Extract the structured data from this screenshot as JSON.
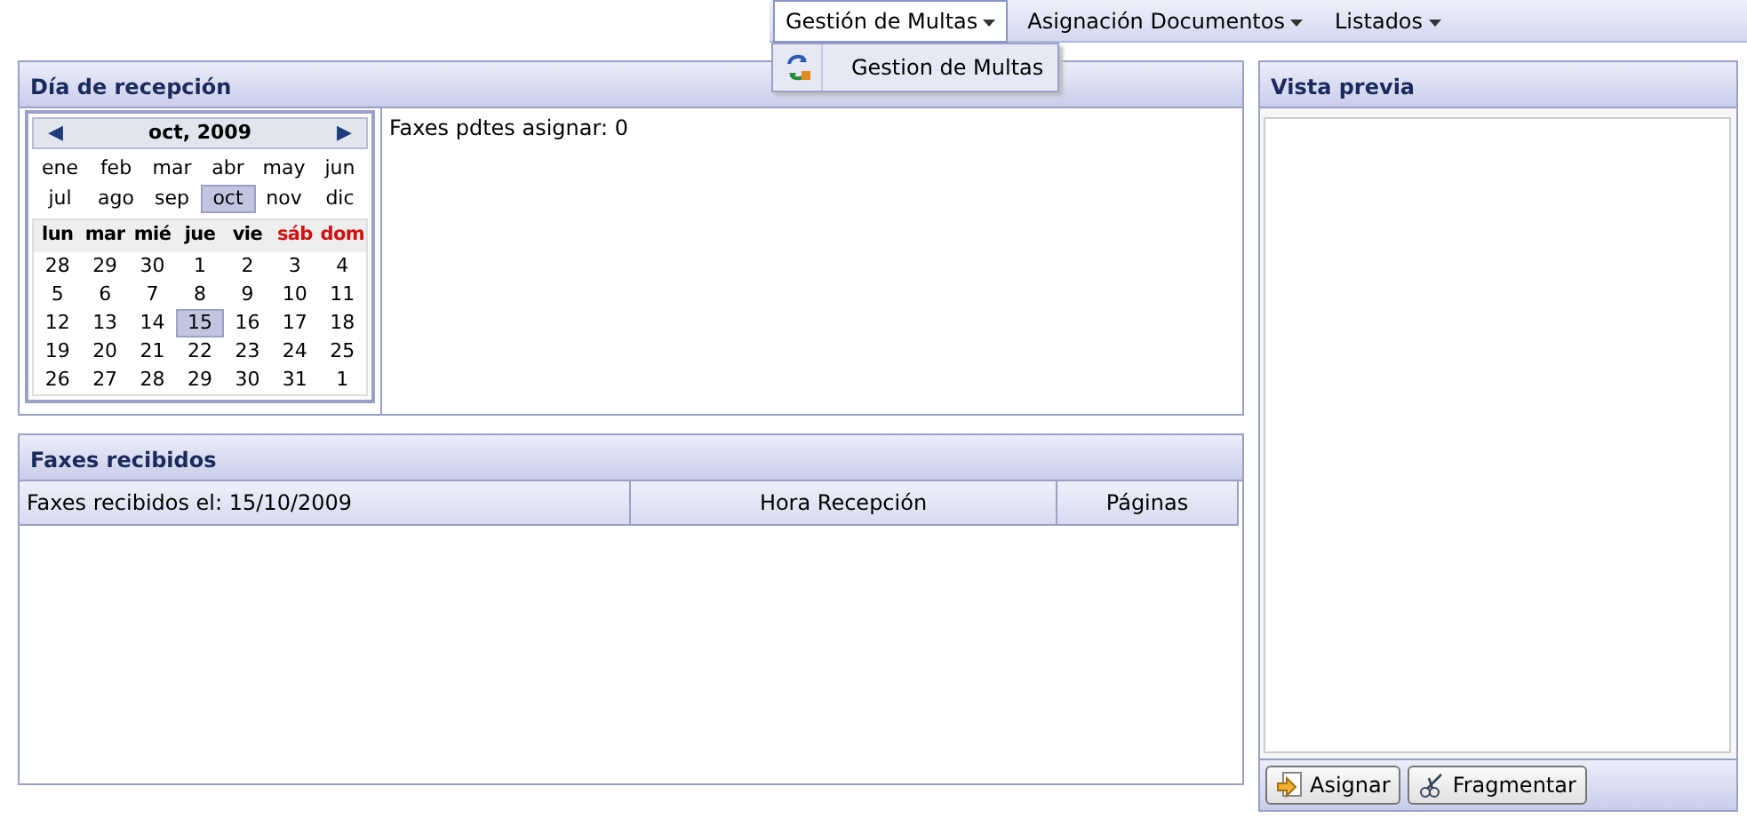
{
  "menubar": [
    {
      "label": "Gestión de Multas",
      "expanded": true,
      "items": [
        {
          "label": "Gestion de Multas"
        }
      ]
    },
    {
      "label": "Asignación Documentos",
      "expanded": false
    },
    {
      "label": "Listados",
      "expanded": false
    }
  ],
  "reception": {
    "title": "Día de recepción",
    "calendar": {
      "prev": "◀",
      "next": "▶",
      "title": "oct, 2009",
      "months": [
        {
          "label": "ene",
          "selected": false
        },
        {
          "label": "feb",
          "selected": false
        },
        {
          "label": "mar",
          "selected": false
        },
        {
          "label": "abr",
          "selected": false
        },
        {
          "label": "may",
          "selected": false
        },
        {
          "label": "jun",
          "selected": false
        },
        {
          "label": "jul",
          "selected": false
        },
        {
          "label": "ago",
          "selected": false
        },
        {
          "label": "sep",
          "selected": false
        },
        {
          "label": "oct",
          "selected": true
        },
        {
          "label": "nov",
          "selected": false
        },
        {
          "label": "dic",
          "selected": false
        }
      ],
      "weekdays": [
        {
          "label": "lun",
          "weekend": false
        },
        {
          "label": "mar",
          "weekend": false
        },
        {
          "label": "mié",
          "weekend": false
        },
        {
          "label": "jue",
          "weekend": false
        },
        {
          "label": "vie",
          "weekend": false
        },
        {
          "label": "sáb",
          "weekend": true
        },
        {
          "label": "dom",
          "weekend": true
        }
      ],
      "weeks": [
        [
          {
            "label": "28",
            "selected": false
          },
          {
            "label": "29",
            "selected": false
          },
          {
            "label": "30",
            "selected": false
          },
          {
            "label": "1",
            "selected": false
          },
          {
            "label": "2",
            "selected": false
          },
          {
            "label": "3",
            "selected": false
          },
          {
            "label": "4",
            "selected": false
          }
        ],
        [
          {
            "label": "5",
            "selected": false
          },
          {
            "label": "6",
            "selected": false
          },
          {
            "label": "7",
            "selected": false
          },
          {
            "label": "8",
            "selected": false
          },
          {
            "label": "9",
            "selected": false
          },
          {
            "label": "10",
            "selected": false
          },
          {
            "label": "11",
            "selected": false
          }
        ],
        [
          {
            "label": "12",
            "selected": false
          },
          {
            "label": "13",
            "selected": false
          },
          {
            "label": "14",
            "selected": false
          },
          {
            "label": "15",
            "selected": true
          },
          {
            "label": "16",
            "selected": false
          },
          {
            "label": "17",
            "selected": false
          },
          {
            "label": "18",
            "selected": false
          }
        ],
        [
          {
            "label": "19",
            "selected": false
          },
          {
            "label": "20",
            "selected": false
          },
          {
            "label": "21",
            "selected": false
          },
          {
            "label": "22",
            "selected": false
          },
          {
            "label": "23",
            "selected": false
          },
          {
            "label": "24",
            "selected": false
          },
          {
            "label": "25",
            "selected": false
          }
        ],
        [
          {
            "label": "26",
            "selected": false
          },
          {
            "label": "27",
            "selected": false
          },
          {
            "label": "28",
            "selected": false
          },
          {
            "label": "29",
            "selected": false
          },
          {
            "label": "30",
            "selected": false
          },
          {
            "label": "31",
            "selected": false
          },
          {
            "label": "1",
            "selected": false
          }
        ]
      ]
    },
    "pending": "Faxes pdtes asignar: 0"
  },
  "faxes": {
    "title": "Faxes recibidos",
    "columns": [
      "Faxes recibidos el: 15/10/2009",
      "Hora Recepción",
      "Páginas"
    ]
  },
  "preview": {
    "title": "Vista previa",
    "buttons": [
      {
        "label": "Asignar",
        "kind": "assign"
      },
      {
        "label": "Fragmentar",
        "kind": "split"
      }
    ]
  }
}
